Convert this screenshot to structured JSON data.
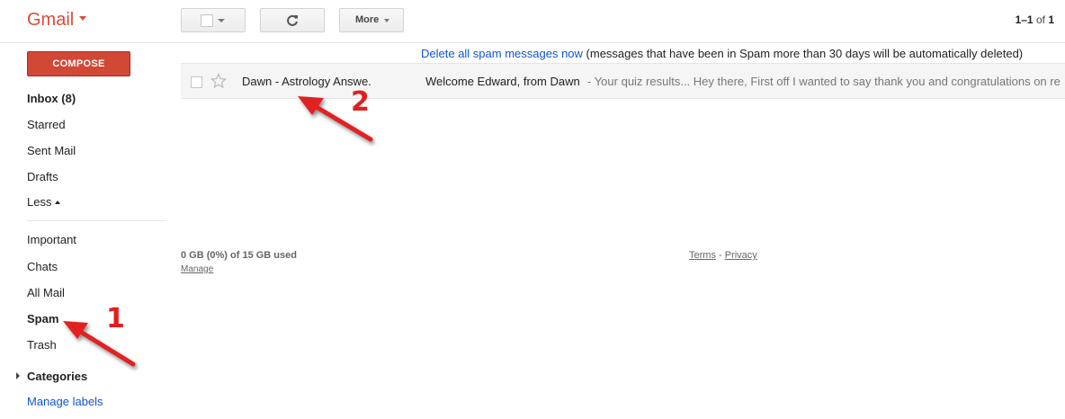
{
  "header": {
    "logo": "Gmail",
    "more_label": "More",
    "pager": {
      "range": "1–1",
      "of": "of",
      "total": "1"
    }
  },
  "sidebar": {
    "compose_label": "COMPOSE",
    "items": [
      {
        "label": "Inbox (8)",
        "bold": true
      },
      {
        "label": "Starred"
      },
      {
        "label": "Sent Mail"
      },
      {
        "label": "Drafts"
      },
      {
        "label": "Less"
      },
      {
        "label": "Important"
      },
      {
        "label": "Chats"
      },
      {
        "label": "All Mail"
      },
      {
        "label": "Spam",
        "bold": true
      },
      {
        "label": "Trash"
      }
    ],
    "categories_label": "Categories",
    "manage_labels": "Manage labels"
  },
  "notice": {
    "link": "Delete all spam messages now",
    "text": " (messages that have been in Spam more than 30 days will be automatically deleted)"
  },
  "messages": [
    {
      "sender": "Dawn - Astrology Answe.",
      "subject": "Welcome Edward, from Dawn",
      "snippet": "- Your quiz results... Hey there, First off I wanted to say thank you and congratulations on re"
    }
  ],
  "footer": {
    "storage": "0 GB (0%) of 15 GB used",
    "manage": "Manage",
    "terms": "Terms",
    "separator": " - ",
    "privacy": "Privacy"
  },
  "annotations": {
    "one": "1",
    "two": "2"
  },
  "colors": {
    "brand_red": "#dd4b39",
    "compose_red": "#d14836",
    "link_blue": "#1155cc",
    "annotation_red": "#e02020"
  }
}
